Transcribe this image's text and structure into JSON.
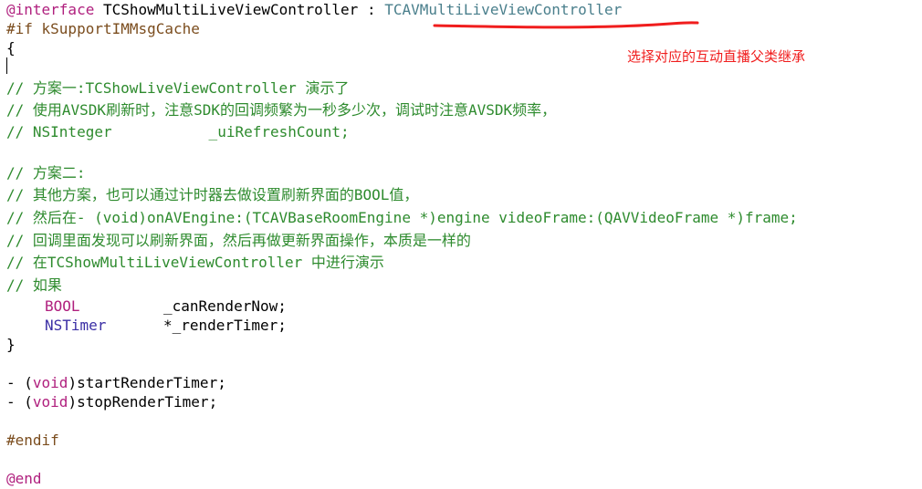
{
  "code": {
    "interface_kw": "@interface",
    "interface_name": " TCShowMultiLiveViewController : ",
    "superclass": "TCAVMultiLiveViewController",
    "if_directive": "#if kSupportIMMsgCache",
    "open_brace": "{",
    "c1": "// 方案一:TCShowLiveViewController 演示了",
    "c2": "// 使用AVSDK刷新时，注意SDK的回调频繁为一秒多少次，调试时注意AVSDK频率，",
    "c3": "// NSInteger           _uiRefreshCount;",
    "c4": "// 方案二:",
    "c5": "// 其他方案，也可以通过计时器去做设置刷新界面的BOOL值，",
    "c6": "// 然后在- (void)onAVEngine:(TCAVBaseRoomEngine *)engine videoFrame:(QAVVideoFrame *)frame;",
    "c7": "// 回调里面发现可以刷新界面，然后再做更新界面操作，本质是一样的",
    "c8": "// 在TCShowMultiLiveViewController 中进行演示",
    "c9": "// 如果",
    "ivar1_type": "BOOL",
    "ivar1_name": "_canRenderNow;",
    "ivar2_type": "NSTimer",
    "ivar2_name": "*_renderTimer;",
    "close_brace": "}",
    "m1_prefix": "- (",
    "m1_void": "void",
    "m1_rest": ")startRenderTimer;",
    "m2_prefix": "- (",
    "m2_void": "void",
    "m2_rest": ")stopRenderTimer;",
    "endif": "#endif",
    "end_kw": "@end"
  },
  "annotation": {
    "text": "选择对应的互动直播父类继承"
  },
  "colors": {
    "at_keyword": "#b0207e",
    "preprocessor": "#7b4d1e",
    "comment": "#2e8b2e",
    "class_ref": "#4a7f8c",
    "annotation_red": "#f01d1d"
  }
}
